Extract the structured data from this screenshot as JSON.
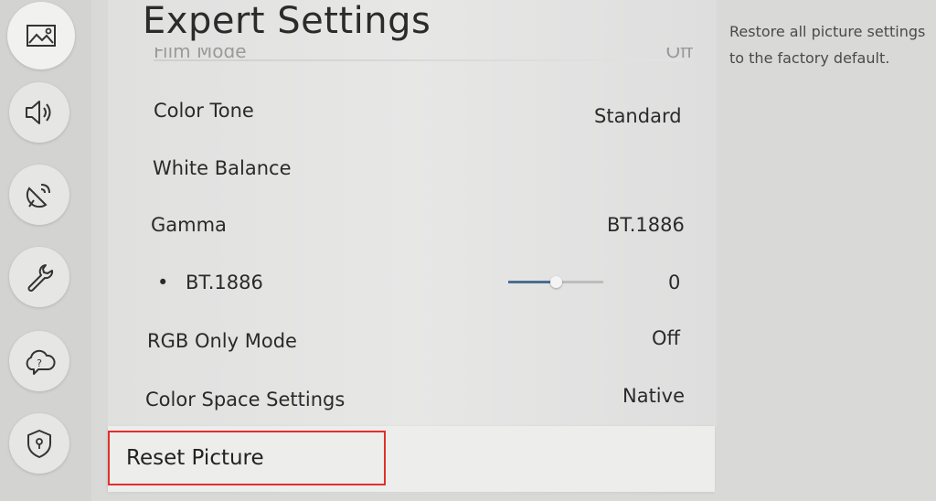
{
  "page": {
    "title": "Expert Settings"
  },
  "sidebar": {
    "items": [
      {
        "name": "picture",
        "icon": "picture-icon",
        "active": true
      },
      {
        "name": "sound",
        "icon": "sound-icon"
      },
      {
        "name": "broadcasting",
        "icon": "broadcast-icon"
      },
      {
        "name": "general",
        "icon": "wrench-icon"
      },
      {
        "name": "support",
        "icon": "support-cloud-icon"
      },
      {
        "name": "privacy",
        "icon": "shield-icon"
      }
    ]
  },
  "settings": {
    "faded": {
      "label": "Film Mode",
      "value": "Off"
    },
    "rows": [
      {
        "label": "Color Tone",
        "value": "Standard"
      },
      {
        "label": "White Balance",
        "value": ""
      },
      {
        "label": "Gamma",
        "value": "BT.1886"
      },
      {
        "label": "BT.1886",
        "value": "0",
        "bullet": "•",
        "slider_fraction": 0.5
      },
      {
        "label": "RGB Only Mode",
        "value": "Off"
      },
      {
        "label": "Color Space Settings",
        "value": "Native"
      }
    ],
    "reset": {
      "label": "Reset Picture"
    }
  },
  "description": {
    "text": "Restore all picture settings to the factory default."
  },
  "colors": {
    "highlight_border": "#e0302a",
    "slider_fill": "#4a6f8f"
  }
}
